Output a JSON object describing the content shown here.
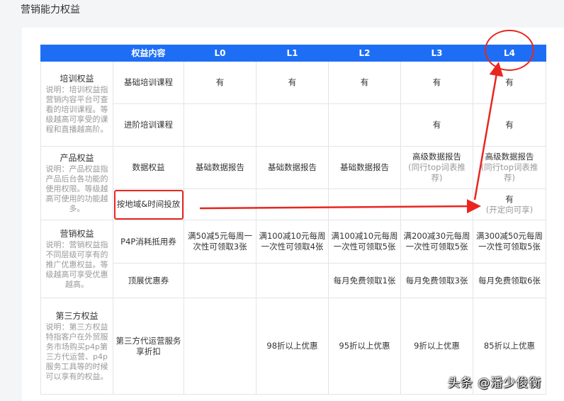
{
  "page_title": "营销能力权益",
  "table": {
    "headers": [
      "",
      "权益内容",
      "L0",
      "L1",
      "L2",
      "L3",
      "L4"
    ],
    "categories": [
      {
        "title": "培训权益",
        "desc": "说明：培训权益指营销内容平台可查看的培训课程。等级越高可享受的课程和直播越高阶。"
      },
      {
        "title": "产品权益",
        "desc": "说明：产品权益指产品后台各功能的使用权限。等级越高可使用的功能越多。"
      },
      {
        "title": "营销权益",
        "desc": "说明：营销权益指不同层级可享有的推广优惠权益。等级越高可享受优惠越高。"
      },
      {
        "title": "第三方权益",
        "desc": "说明：第三方权益特指客户在外贸服务市场购买p4p第三方代运营、p4p服务工具等的时候可以享有的权益。"
      }
    ],
    "rows": [
      {
        "name": "基础培训课程",
        "cells": [
          "有",
          "有",
          "有",
          "有",
          "有"
        ]
      },
      {
        "name": "进阶培训课程",
        "cells": [
          "",
          "",
          "",
          "有",
          "有"
        ]
      },
      {
        "name": "数据权益",
        "cells": [
          "基础数据报告",
          "基础数据报告",
          "基础数据报告",
          "高级数据报告",
          "高级数据报告"
        ],
        "notes": [
          "",
          "",
          "",
          "(同行top词表推荐)",
          "(同行top词表推荐)"
        ]
      },
      {
        "name": "按地域&时间投放",
        "cells": [
          "",
          "",
          "",
          "",
          "有"
        ],
        "notes": [
          "",
          "",
          "",
          "",
          "(开定向可享)"
        ]
      },
      {
        "name": "P4P消耗抵用券",
        "cells": [
          "满50减5元每周一次性可领取3张",
          "满100减10元每周一次性可领取4张",
          "满100减10元每周一次性可领取5张",
          "满200减30元每周一次性可领取5张",
          "满300减50元每周一次性可领取5张"
        ]
      },
      {
        "name": "顶展优惠券",
        "cells": [
          "",
          "",
          "每月免费领取1张",
          "每月免费领取3张",
          "每月免费领取6张"
        ]
      },
      {
        "name": "第三方代运营服务享折扣",
        "cells": [
          "",
          "98折以上优惠",
          "95折以上优惠",
          "9折以上优惠",
          "85折以上优惠"
        ]
      }
    ]
  },
  "watermark": "头条 @潘少俊衡",
  "colors": {
    "header_bg": "#1e6ef5",
    "annotation": "#e8261f",
    "muted_text": "#999999"
  }
}
